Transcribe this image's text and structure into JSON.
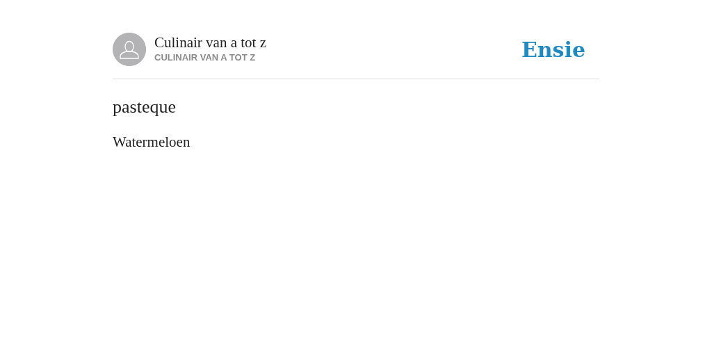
{
  "author": {
    "name": "Culinair van a tot z",
    "subtitle": "CULINAIR VAN A TOT Z"
  },
  "logo": "Ensie",
  "entry": {
    "title": "pasteque",
    "definition": "Watermeloen"
  }
}
